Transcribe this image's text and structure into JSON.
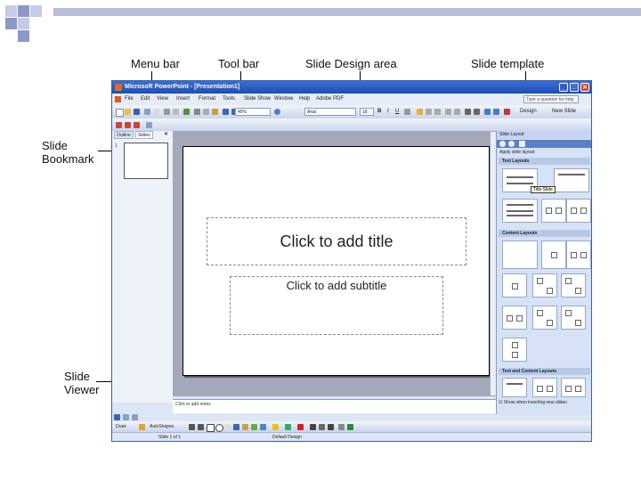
{
  "annotations": {
    "menu_bar": "Menu bar",
    "tool_bar": "Tool bar",
    "slide_design_area": "Slide Design area",
    "slide_template": "Slide template",
    "slide_bookmark_line1": "Slide",
    "slide_bookmark_line2": "Bookmark",
    "slide_viewer_line1": "Slide",
    "slide_viewer_line2": "Viewer"
  },
  "window": {
    "title": "Microsoft PowerPoint - [Presentation1]",
    "help_placeholder": "Type a question for help",
    "menu": [
      "File",
      "Edit",
      "View",
      "Insert",
      "Format",
      "Tools",
      "Slide Show",
      "Window",
      "Help",
      "Adobe PDF"
    ]
  },
  "toolbar": {
    "zoom": "45%",
    "font": "Arial",
    "size": "18",
    "bold": "B",
    "italic": "I",
    "underline": "U",
    "design_label": "Design",
    "new_slide_label": "New Slide"
  },
  "left_pane": {
    "tab_outline": "Outline",
    "tab_slides": "Slides",
    "close": "✕",
    "thumb_number": "1"
  },
  "slide": {
    "title_placeholder": "Click to add title",
    "subtitle_placeholder": "Click to add subtitle"
  },
  "notes": "Click to add notes",
  "task_pane": {
    "title": "Slide Layout",
    "apply_label": "Apply slide layout:",
    "section_text_layouts": "Text Layouts",
    "section_content_layouts": "Content Layouts",
    "section_text_and_content": "Text and Content Layouts",
    "tooltip": "Title Slide",
    "footer_checkbox": "Show when inserting new slides"
  },
  "drawing_toolbar": {
    "draw": "Draw",
    "autoshapes": "AutoShapes"
  },
  "status_bar": {
    "slide_info": "Slide 1 of 1",
    "design_name": "Default Design"
  },
  "colors": {
    "title_bar": "#2a5fc7",
    "canvas_bg": "#a3a9b9",
    "decor_squares": "#aab2d6"
  }
}
